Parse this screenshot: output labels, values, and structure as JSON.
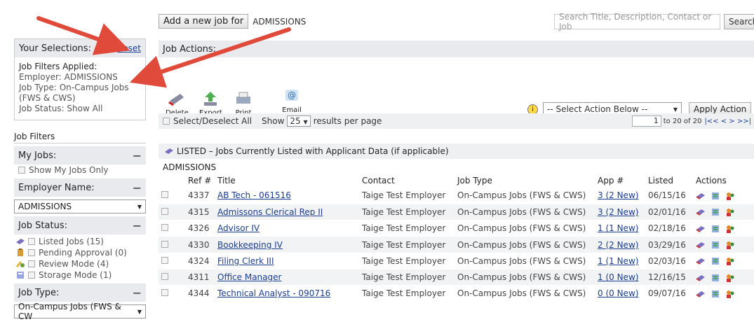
{
  "top": {
    "add_job_label": "Add a new job for",
    "employer": "ADMISSIONS",
    "search_placeholder": "Search Title, Description, Contact or Job",
    "search_button": "Search"
  },
  "selections": {
    "title": "Your Selections:",
    "reset": "Reset",
    "applied_label": "Job Filters Applied:",
    "employer": "Employer: ADMISSIONS",
    "job_type": "Job Type: On-Campus Jobs (FWS & CWS)",
    "job_status": "Job Status: Show All"
  },
  "filters": {
    "title": "Job Filters",
    "my_jobs": {
      "label": "My Jobs:",
      "option": "Show My Jobs Only"
    },
    "employer_name": {
      "label": "Employer Name:",
      "value": "ADMISSIONS"
    },
    "job_status": {
      "label": "Job Status:",
      "options": [
        "Listed Jobs (15)",
        "Pending Approval (0)",
        "Review Mode (4)",
        "Storage Mode (1)"
      ]
    },
    "job_type": {
      "label": "Job Type:",
      "value": "On-Campus Jobs (FWS & CW"
    }
  },
  "actions": {
    "title": "Job Actions:",
    "tools": [
      "Delete",
      "Export",
      "Print",
      "Email Supervisors"
    ],
    "select_placeholder": "-- Select Action Below --",
    "apply": "Apply Action"
  },
  "pager": {
    "select_all": "Select/Deselect All",
    "show": "Show",
    "per_page": "25",
    "results_label": "results per page",
    "page": "1",
    "range_text": "to 20 of 20",
    "nav": "|<<  <  >  >>|"
  },
  "listing": {
    "heading": "LISTED – Jobs Currently Listed with Applicant Data (if applicable)",
    "group": "ADMISSIONS",
    "columns": [
      "Ref #",
      "Title",
      "Contact",
      "Job Type",
      "App #",
      "Listed",
      "Actions"
    ],
    "rows": [
      {
        "ref": "4337",
        "title": "AB Tech - 061516",
        "contact": "Taige Test Employer",
        "type": "On-Campus Jobs (FWS & CWS)",
        "app": "3 (2 New)",
        "listed": "06/15/16"
      },
      {
        "ref": "4315",
        "title": "Admissons Clerical Rep II",
        "contact": "Taige Test Employer",
        "type": "On-Campus Jobs (FWS & CWS)",
        "app": "3 (2 New)",
        "listed": "02/01/16"
      },
      {
        "ref": "4326",
        "title": "Advisor IV",
        "contact": "Taige Test Employer",
        "type": "On-Campus Jobs (FWS & CWS)",
        "app": "1 (1 New)",
        "listed": "02/18/16"
      },
      {
        "ref": "4330",
        "title": "Bookkeeping IV",
        "contact": "Taige Test Employer",
        "type": "On-Campus Jobs (FWS & CWS)",
        "app": "2 (2 New)",
        "listed": "03/29/16"
      },
      {
        "ref": "4324",
        "title": "Filing Clerk III",
        "contact": "Taige Test Employer",
        "type": "On-Campus Jobs (FWS & CWS)",
        "app": "1 (1 New)",
        "listed": "02/03/16"
      },
      {
        "ref": "4311",
        "title": "Office Manager",
        "contact": "Taige Test Employer",
        "type": "On-Campus Jobs (FWS & CWS)",
        "app": "1 (0 New)",
        "listed": "12/16/15"
      },
      {
        "ref": "4344",
        "title": "Technical Analyst - 090716",
        "contact": "Taige Test Employer",
        "type": "On-Campus Jobs (FWS & CWS)",
        "app": "0 (0 New)",
        "listed": "09/07/16"
      }
    ]
  },
  "colors": {
    "link": "#1a3d8f",
    "header_bg": "#e8eaed",
    "arrow": "#e04a3a"
  }
}
